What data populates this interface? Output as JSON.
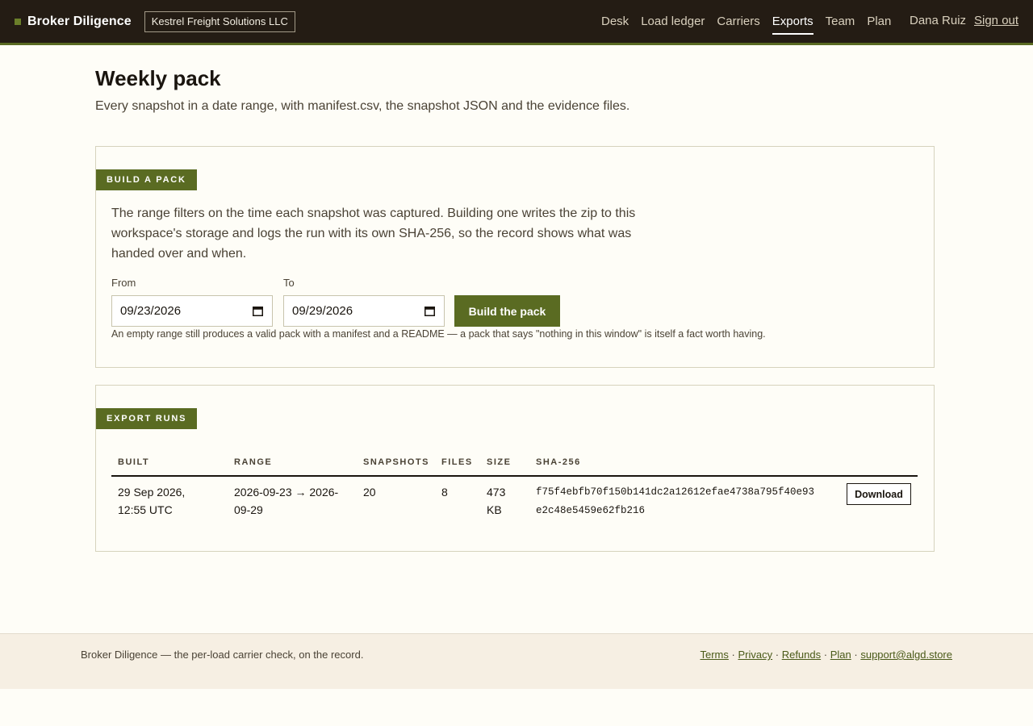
{
  "header": {
    "brand": "Broker Diligence",
    "org": "Kestrel Freight Solutions LLC",
    "nav": [
      "Desk",
      "Load ledger",
      "Carriers",
      "Exports",
      "Team",
      "Plan"
    ],
    "active_nav": "Exports",
    "user": "Dana Ruiz",
    "sign_out": "Sign out"
  },
  "page": {
    "title": "Weekly pack",
    "subtitle": "Every snapshot in a date range, with manifest.csv, the snapshot JSON and the evidence files."
  },
  "build": {
    "tag": "BUILD A PACK",
    "description": "The range filters on the time each snapshot was captured. Building one writes the zip to this workspace's storage and logs the run with its own SHA-256, so the record shows what was handed over and when.",
    "from_label": "From",
    "from_value": "09/23/2026",
    "to_label": "To",
    "to_value": "09/29/2026",
    "button": "Build the pack",
    "hint": "An empty range still produces a valid pack with a manifest and a README — a pack that says \"nothing in this window\" is itself a fact worth having."
  },
  "runs": {
    "tag": "EXPORT RUNS",
    "columns": [
      "BUILT",
      "RANGE",
      "SNAPSHOTS",
      "FILES",
      "SIZE",
      "SHA-256"
    ],
    "rows": [
      {
        "built_line1": "29 Sep 2026,",
        "built_line2": "12:55 UTC",
        "range_line1": "2026-09-23 → 2026-",
        "range_line2": "09-29",
        "snapshots": "20",
        "files": "8",
        "size_line1": "473",
        "size_line2": "KB",
        "sha_line1": "f75f4ebfb70f150b141dc2a12612efae4738a795f40e93",
        "sha_line2": "e2c48e5459e62fb216",
        "action": "Download"
      }
    ]
  },
  "footer": {
    "tagline": "Broker Diligence — the per-load carrier check, on the record.",
    "links": [
      "Terms",
      "Privacy",
      "Refunds",
      "Plan",
      "support@algd.store"
    ],
    "separator": "·"
  },
  "colors": {
    "accent": "#5a6b22",
    "topbar": "#241c14",
    "background": "#fefdf7"
  }
}
